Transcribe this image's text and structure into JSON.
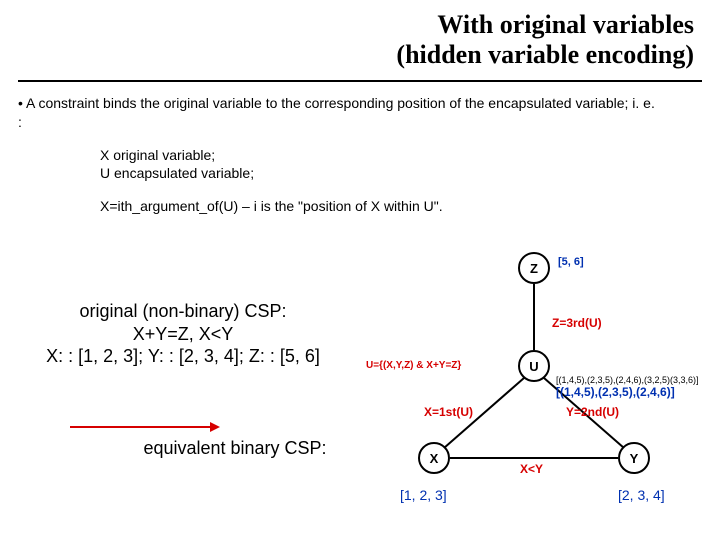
{
  "title": {
    "line1": "With original variables",
    "line2": "(hidden variable encoding)"
  },
  "intro": {
    "bullet": "• A constraint binds the original variable to the corresponding position of the encapsulated variable; i. e. :",
    "defs_line1": "X  original variable;",
    "defs_line2": "U encapsulated variable;",
    "rule": "X=ith_argument_of(U) –  i is the \"position of X within U\"."
  },
  "csp": {
    "caption": "original (non-binary) CSP:",
    "constraints": "X+Y=Z, X<Y",
    "domains": "X: : [1, 2, 3]; Y: : [2, 3, 4]; Z: : [5, 6]",
    "equivalent": "equivalent binary CSP:"
  },
  "graph": {
    "nodes": {
      "Z": "Z",
      "U": "U",
      "X": "X",
      "Y": "Y"
    },
    "red_labels": {
      "z_eq": "Z=3rd(U)",
      "u_def": "U={(X,Y,Z) & X+Y=Z}",
      "x_eq": "X=1st(U)",
      "y_eq": "Y=2nd(U)",
      "xy": "X<Y"
    },
    "blue_labels": {
      "z_dom": "[5, 6]",
      "u_tuples_full": "[(1,4,5),(2,3,5),(2,4,6),(3,2,5)(3,3,6)]",
      "u_tuples_short": "[(1,4,5),(2,3,5),(2,4,6)]",
      "x_dom": "[1, 2, 3]",
      "y_dom": "[2, 3, 4]"
    }
  }
}
